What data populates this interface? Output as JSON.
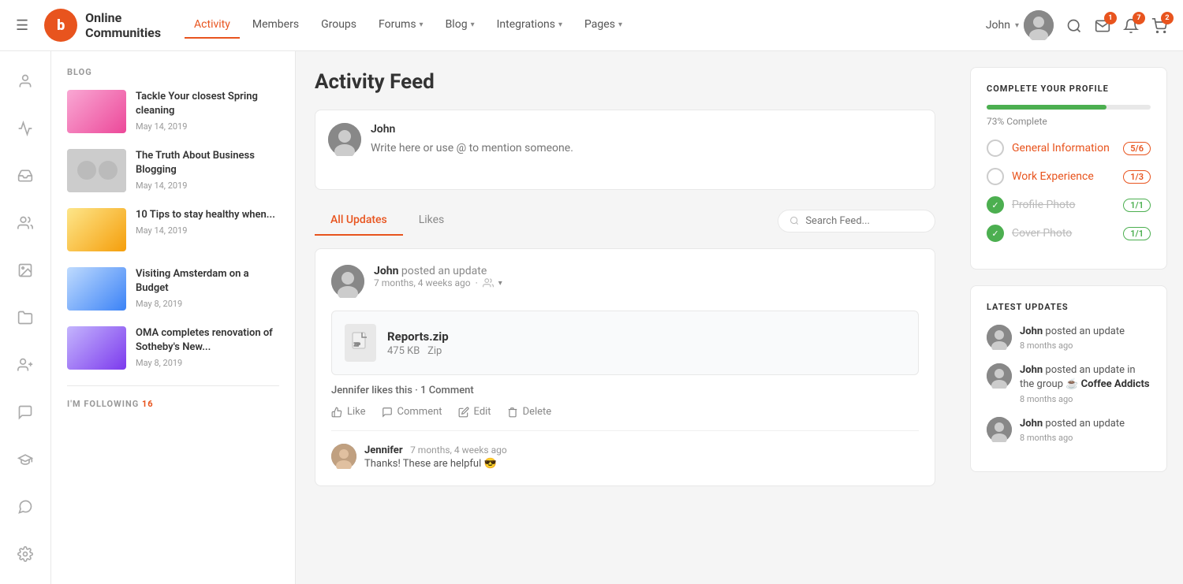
{
  "nav": {
    "brand": {
      "name1": "Online",
      "name2": "Communities"
    },
    "links": [
      {
        "label": "Activity",
        "active": true,
        "hasDropdown": false
      },
      {
        "label": "Members",
        "active": false,
        "hasDropdown": false
      },
      {
        "label": "Groups",
        "active": false,
        "hasDropdown": false
      },
      {
        "label": "Forums",
        "active": false,
        "hasDropdown": true
      },
      {
        "label": "Blog",
        "active": false,
        "hasDropdown": true
      },
      {
        "label": "Integrations",
        "active": false,
        "hasDropdown": true
      },
      {
        "label": "Pages",
        "active": false,
        "hasDropdown": true
      }
    ],
    "user": "John",
    "badges": {
      "messages": "1",
      "notifications": "7",
      "cart": "2"
    }
  },
  "blog": {
    "section_label": "BLOG",
    "items": [
      {
        "title": "Tackle Your closest Spring cleaning",
        "date": "May 14, 2019",
        "thumb_color": "thumb-pink"
      },
      {
        "title": "The Truth About Business Blogging",
        "date": "May 14, 2019",
        "thumb_color": "thumb-gray"
      },
      {
        "title": "10 Tips to stay healthy when...",
        "date": "May 14, 2019",
        "thumb_color": "thumb-food"
      },
      {
        "title": "Visiting Amsterdam on a Budget",
        "date": "May 8, 2019",
        "thumb_color": "thumb-blue"
      },
      {
        "title": "OMA completes renovation of Sotheby's New...",
        "date": "May 8, 2019",
        "thumb_color": "thumb-dark"
      }
    ],
    "following_label": "I'M FOLLOWING",
    "following_count": "16"
  },
  "feed": {
    "title": "Activity Feed",
    "composer": {
      "user": "John",
      "placeholder": "Write here or use @ to mention someone."
    },
    "tabs": [
      {
        "label": "All Updates",
        "active": true
      },
      {
        "label": "Likes",
        "active": false
      }
    ],
    "search_placeholder": "Search Feed...",
    "posts": [
      {
        "author": "John",
        "action": "posted an update",
        "time": "7 months, 4 weeks ago",
        "file": {
          "name": "Reports.zip",
          "size": "475 KB",
          "type": "Zip"
        },
        "likes_text": "Jennifer likes this",
        "comments_count": "1 Comment",
        "actions": [
          "Like",
          "Comment",
          "Edit",
          "Delete"
        ],
        "comment": {
          "author": "Jennifer",
          "time": "7 months, 4 weeks ago",
          "text": "Thanks! These are helpful 😎"
        }
      }
    ]
  },
  "profile_complete": {
    "title": "COMPLETE YOUR PROFILE",
    "progress_percent": 73,
    "progress_label": "73% Complete",
    "items": [
      {
        "label": "General Information",
        "badge": "5/6",
        "done": false
      },
      {
        "label": "Work Experience",
        "badge": "1/3",
        "done": false
      },
      {
        "label": "Profile Photo",
        "badge": "1/1",
        "done": true
      },
      {
        "label": "Cover Photo",
        "badge": "1/1",
        "done": true
      }
    ]
  },
  "latest_updates": {
    "title": "LATEST UPDATES",
    "items": [
      {
        "author": "John",
        "text": "posted an update",
        "time": "8 months ago"
      },
      {
        "author": "John",
        "text": "posted an update in the group",
        "group": "Coffee Addicts",
        "time": "8 months ago"
      },
      {
        "author": "John",
        "text": "posted an update",
        "time": "8 months ago"
      }
    ]
  },
  "sidebar_icons": [
    "person",
    "activity",
    "inbox",
    "group",
    "image",
    "folder",
    "user-add",
    "chat",
    "graduation",
    "comment"
  ]
}
